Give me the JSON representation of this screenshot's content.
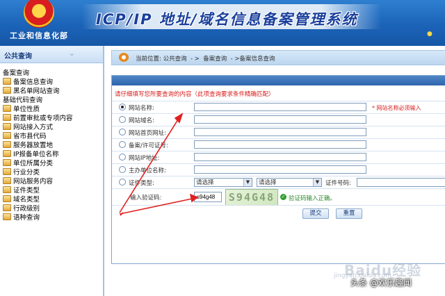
{
  "header": {
    "ministry_name": "工业和信息化部",
    "system_title": "ICP/IP 地址/域名信息备案管理系统",
    "corner_icon": "home-icon"
  },
  "sidebar": {
    "title": "公共查询",
    "groups": [
      {
        "label": "备案查询",
        "items": [
          "备案信息查询",
          "黑名单网站查询"
        ]
      },
      {
        "label": "基础代码查询",
        "items": [
          "单位性质",
          "前置审批或专项内容",
          "网站接入方式",
          "省市县代码",
          "服务器放置地",
          "IP报备单位名称",
          "单位所属分类",
          "行业分类",
          "网站服务内容",
          "证件类型",
          "域名类型",
          "行政级别",
          "语种查询"
        ]
      }
    ]
  },
  "breadcrumb": {
    "text": "当前位置: 公共查询  - >  备案查询  - >备案信息查询"
  },
  "form": {
    "notice": "请仔细填写您所要查询的内容（此项查询要求条件精确匹配）",
    "fields": [
      {
        "label": "网站名称:",
        "value": "",
        "selected": true
      },
      {
        "label": "网站域名:",
        "value": "",
        "selected": false
      },
      {
        "label": "网站首页网址:",
        "value": "",
        "selected": false
      },
      {
        "label": "备案/许可证号:",
        "value": "",
        "selected": false
      },
      {
        "label": "网站IP地址:",
        "value": "",
        "selected": false
      },
      {
        "label": "主办单位名称:",
        "value": "",
        "selected": false
      }
    ],
    "required_note": "* 网站名称必须输入",
    "cert_type_label": "证件类型:",
    "select_placeholder_1": "请选择",
    "select_placeholder_2": "请选择",
    "cert_no_label": "证件号码:",
    "captcha_label": "输入验证码:",
    "captcha_value": "s94g48",
    "captcha_image_text": "S94G48",
    "captcha_ok": "验证码输入正确。",
    "submit_label": "提交",
    "reset_label": "重置"
  },
  "watermarks": {
    "baidu": "Baidu经验",
    "jingyan": "jingyan.baidu.com",
    "source": "头条 @欢乐趣闻"
  },
  "colors": {
    "header_blue": "#1b63b8",
    "notice_red": "#d81c1c",
    "arrow_red": "#e02020"
  }
}
